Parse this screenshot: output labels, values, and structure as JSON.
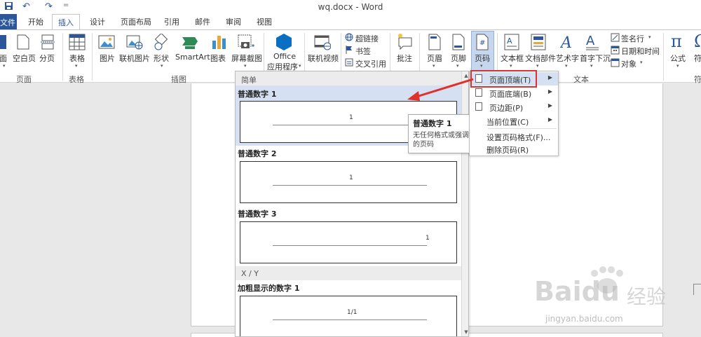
{
  "window": {
    "title": "wq.docx - Word"
  },
  "quick_access": {
    "undo_glyph": "↶",
    "redo_glyph": "↷",
    "customize_glyph": "="
  },
  "tabs": {
    "file": "文件",
    "items": [
      "开始",
      "插入",
      "设计",
      "页面布局",
      "引用",
      "邮件",
      "审阅",
      "视图"
    ],
    "active": "插入"
  },
  "ribbon": {
    "page_group": {
      "cover_partial": "面",
      "blank_page": "空白页",
      "page_break": "分页",
      "label": "页面"
    },
    "table_group": {
      "table": "表格",
      "label": "表格"
    },
    "illustrations_group": {
      "picture": "图片",
      "online_picture": "联机图片",
      "shapes": "形状",
      "smartart": "SmartArt",
      "chart": "图表",
      "screenshot": "屏幕截图",
      "label": "插图"
    },
    "apps_group": {
      "office": "Office",
      "apps": "应用程序"
    },
    "media_group": {
      "online_video": "联机视频"
    },
    "links_group": {
      "hyperlink": "超链接",
      "bookmark": "书签",
      "cross_ref": "交叉引用"
    },
    "comments_group": {
      "comment": "批注"
    },
    "header_footer_group": {
      "header": "页眉",
      "footer": "页脚",
      "page_number": "页码"
    },
    "text_group": {
      "textbox": "文本框",
      "quick_parts": "文档部件",
      "wordart": "艺术字",
      "drop_cap": "首字下沉",
      "signature": "签名行",
      "datetime": "日期和时间",
      "object": "对象",
      "label": "文本"
    },
    "symbols_group": {
      "equation": "公式",
      "symbol_partial": "符"
    }
  },
  "gallery": {
    "section_simple": "简单",
    "items": [
      {
        "label": "普通数字 1",
        "pn": "1"
      },
      {
        "label": "普通数字 2",
        "pn": "1"
      },
      {
        "label": "普通数字 3",
        "pn": "1"
      }
    ],
    "section_xy": "X / Y",
    "bold_item": {
      "label": "加粗显示的数字 1",
      "pn": "1/1"
    }
  },
  "tooltip": {
    "title": "普通数字 1",
    "desc": "无任何格式或强调元素的页码"
  },
  "page_number_menu": {
    "items": [
      {
        "label": "页面顶端(T)"
      },
      {
        "label": "页面底端(B)"
      },
      {
        "label": "页边距(P)"
      },
      {
        "label": "当前位置(C)"
      },
      {
        "label": "设置页码格式(F)..."
      },
      {
        "label": "删除页码(R)"
      }
    ]
  },
  "watermark": {
    "brand": "Baidu",
    "cn": "经验",
    "url": "jingyan.baidu.com"
  },
  "colors": {
    "accent": "#2b579a",
    "highlight": "#d5e1f2",
    "annotation": "#e0302a"
  }
}
